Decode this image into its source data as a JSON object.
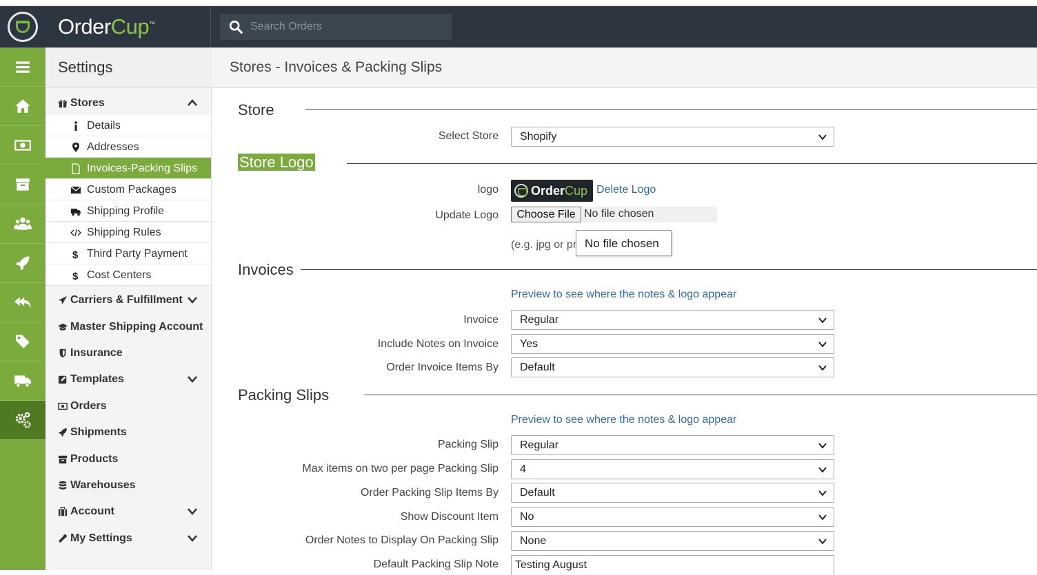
{
  "app": {
    "name_part1": "Order",
    "name_part2": "Cup",
    "trademark": "™",
    "search_placeholder": "Search Orders"
  },
  "rail": [
    "menu-icon",
    "home-icon",
    "money-icon",
    "archive-icon",
    "users-icon",
    "rocket-icon",
    "reply-all-icon",
    "tag-icon",
    "truck-icon",
    "gears-icon"
  ],
  "settings": {
    "title": "Settings",
    "stores": {
      "label": "Stores",
      "items": [
        {
          "label": "Details",
          "icon": "info-icon"
        },
        {
          "label": "Addresses",
          "icon": "map-marker-icon"
        },
        {
          "label": "Invoices-Packing Slips",
          "icon": "file-icon",
          "active": true
        },
        {
          "label": "Custom Packages",
          "icon": "envelope-icon"
        },
        {
          "label": "Shipping Profile",
          "icon": "truck-icon"
        },
        {
          "label": "Third Party Payment",
          "icon": "dollar-icon"
        },
        {
          "label": "Shipping Rules",
          "icon": "code-icon"
        },
        {
          "label": "Cost Centers",
          "icon": "dollar-icon"
        }
      ]
    },
    "sections": [
      {
        "label": "Carriers & Fulfillment",
        "icon": "plane-icon",
        "expandable": true
      },
      {
        "label": "Master Shipping Account",
        "icon": "graduation-cap-icon",
        "expandable": false
      },
      {
        "label": "Insurance",
        "icon": "shield-icon",
        "expandable": false
      },
      {
        "label": "Templates",
        "icon": "edit-icon",
        "expandable": true
      },
      {
        "label": "Orders",
        "icon": "money-icon",
        "expandable": false
      },
      {
        "label": "Shipments",
        "icon": "rocket-icon",
        "expandable": false
      },
      {
        "label": "Products",
        "icon": "archive-icon",
        "expandable": false
      },
      {
        "label": "Warehouses",
        "icon": "database-icon",
        "expandable": false
      },
      {
        "label": "Account",
        "icon": "briefcase-icon",
        "expandable": true
      },
      {
        "label": "My Settings",
        "icon": "wrench-icon",
        "expandable": true
      }
    ]
  },
  "breadcrumb": "Stores - Invoices & Packing Slips",
  "form": {
    "store_heading": "Store",
    "select_store_label": "Select Store",
    "select_store_value": "Shopify",
    "logo_heading": "Store Logo",
    "logo_label": "logo",
    "logo_text_1": "Order",
    "logo_text_2": "Cup",
    "delete_logo": "Delete Logo",
    "update_logo_label": "Update Logo",
    "choose_file": "Choose File",
    "no_file": "No file chosen",
    "hint": "(e.g. jpg or pn",
    "tooltip": "No file chosen",
    "invoices_heading": "Invoices",
    "preview_link": "Preview to see where the notes & logo appear",
    "invoice_label": "Invoice",
    "invoice_value": "Regular",
    "include_notes_label": "Include Notes on Invoice",
    "include_notes_value": "Yes",
    "order_invoice_items_label": "Order Invoice Items By",
    "order_invoice_items_value": "Default",
    "packing_heading": "Packing Slips",
    "packing_slip_label": "Packing Slip",
    "packing_slip_value": "Regular",
    "max_items_label": "Max items on two per page Packing Slip",
    "max_items_value": "4",
    "order_packing_items_label": "Order Packing Slip Items By",
    "order_packing_items_value": "Default",
    "show_discount_label": "Show Discount Item",
    "show_discount_value": "No",
    "order_notes_label": "Order Notes to Display On Packing Slip",
    "order_notes_value": "None",
    "default_note_label": "Default Packing Slip Note",
    "default_note_value": "Testing August"
  }
}
